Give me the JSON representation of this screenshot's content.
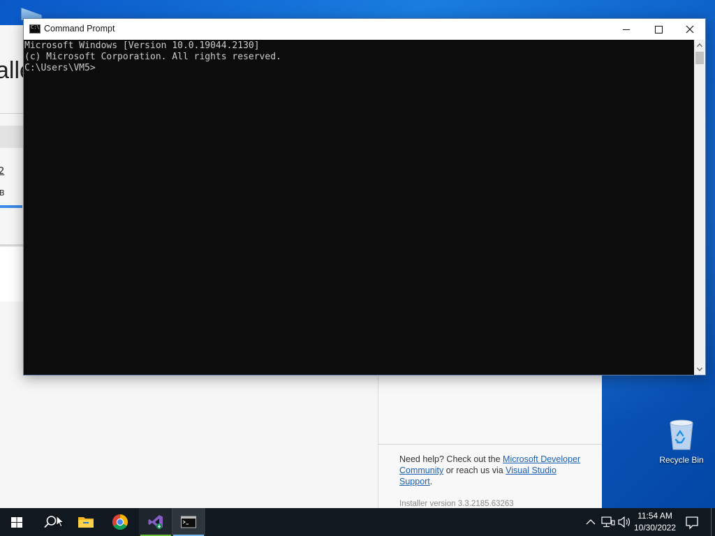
{
  "installer": {
    "title_fragment": "alle",
    "link_fragment": "2",
    "size_fragment": "B",
    "help_prefix": "Need help? Check out the ",
    "help_link1": "Microsoft Developer Community",
    "help_middle": " or reach us via ",
    "help_link2": "Visual Studio Support",
    "help_suffix": ".",
    "version": "Installer version 3.3.2185.63263"
  },
  "cmd": {
    "title": "Command Prompt",
    "console_lines": [
      "Microsoft Windows [Version 10.0.19044.2130]",
      "(c) Microsoft Corporation. All rights reserved.",
      "",
      "C:\\Users\\VM5>"
    ]
  },
  "desktop": {
    "recycle_bin_label": "Recycle Bin"
  },
  "taskbar": {
    "time": "11:54 AM",
    "date": "10/30/2022",
    "pinned": [
      "windows-start-icon",
      "search-icon",
      "file-explorer-icon",
      "chrome-icon",
      "visual-studio-installer-icon",
      "command-prompt-icon"
    ]
  },
  "colors": {
    "console_bg": "#0c0c0c",
    "console_fg": "#cccccc",
    "taskbar_bg": "#101820",
    "link": "#1a5fb4",
    "accent_blue": "#76b9ed"
  }
}
